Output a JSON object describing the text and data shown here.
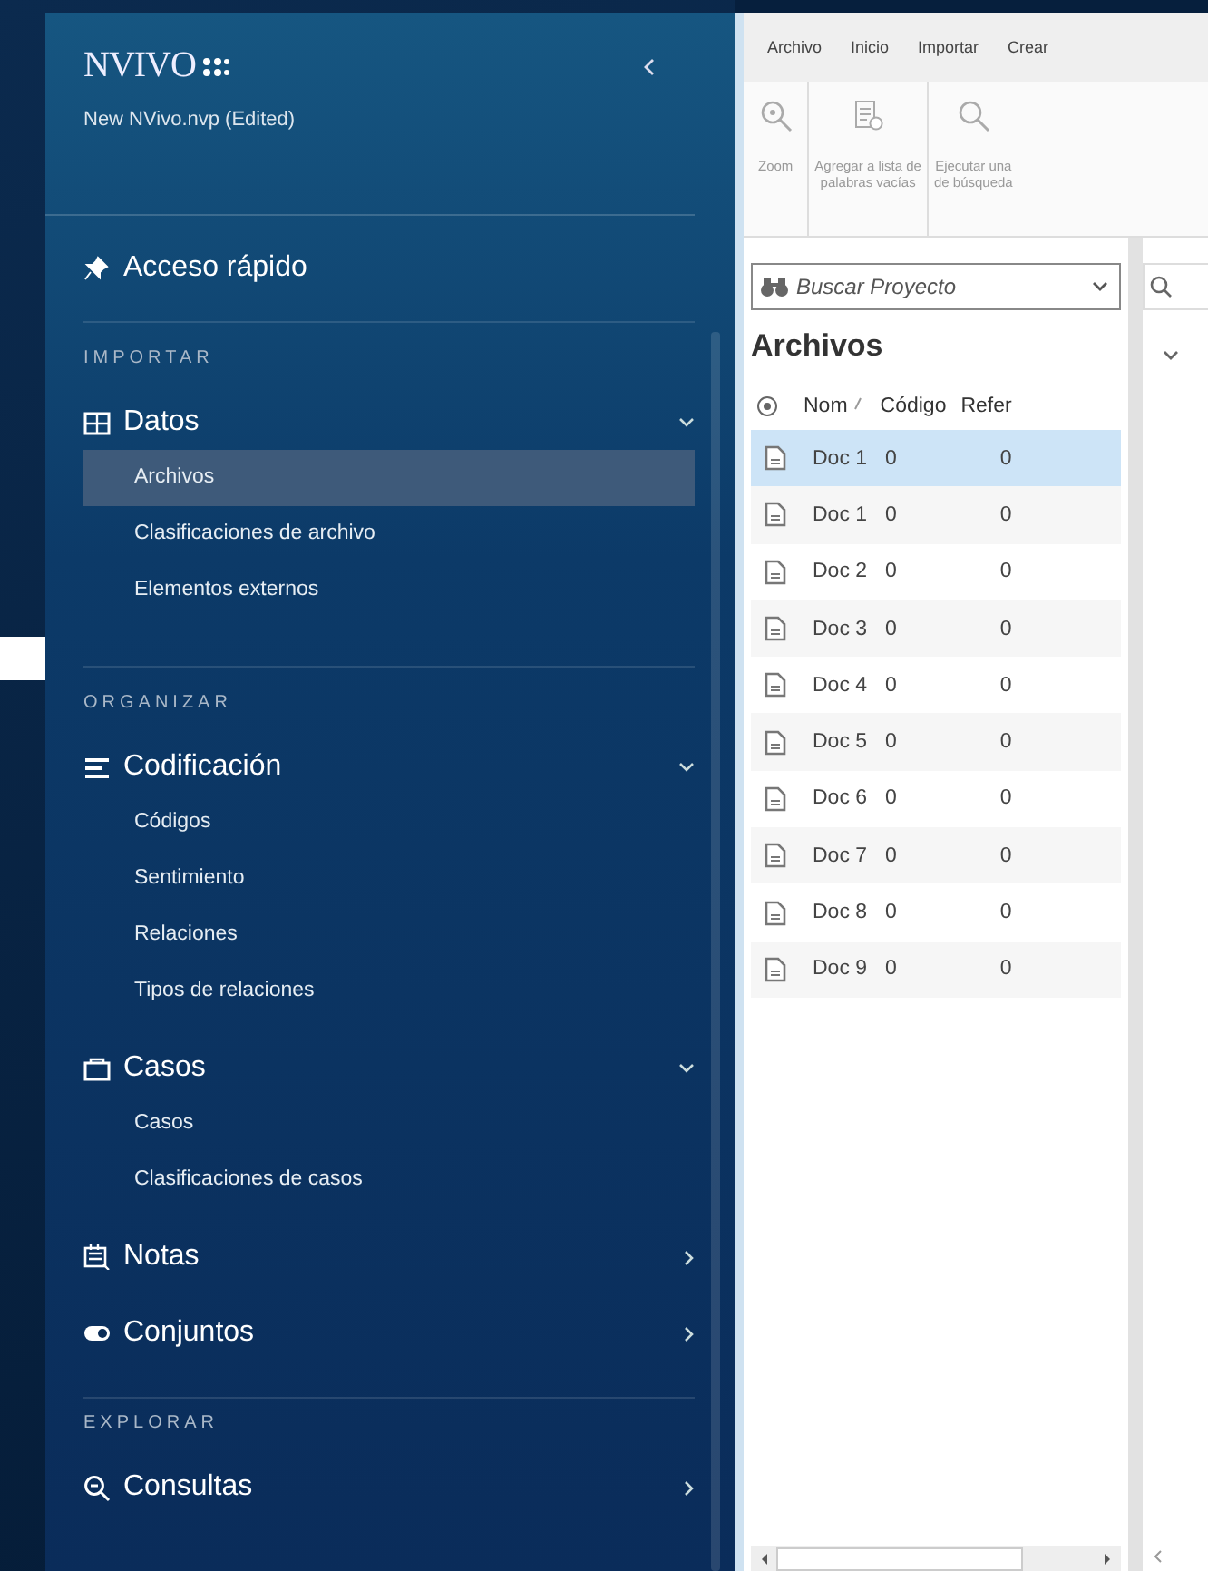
{
  "sidebar": {
    "logo": "NVIVO",
    "project": "New NVivo.nvp (Edited)",
    "quick_access": {
      "label": "Acceso rápido"
    },
    "sections": [
      {
        "title": "IMPORTAR",
        "groups": [
          {
            "label": "Datos",
            "kind": "table",
            "expanded": true,
            "children": [
              {
                "label": "Archivos",
                "selected": true
              },
              {
                "label": "Clasificaciones de archivo",
                "selected": false
              },
              {
                "label": "Elementos externos",
                "selected": false
              }
            ]
          }
        ]
      },
      {
        "title": "ORGANIZAR",
        "groups": [
          {
            "label": "Codificación",
            "kind": "lines",
            "expanded": true,
            "children": [
              {
                "label": "Códigos",
                "selected": false
              },
              {
                "label": "Sentimiento",
                "selected": false
              },
              {
                "label": "Relaciones",
                "selected": false
              },
              {
                "label": "Tipos de relaciones",
                "selected": false
              }
            ]
          },
          {
            "label": "Casos",
            "kind": "case",
            "expanded": true,
            "children": [
              {
                "label": "Casos",
                "selected": false
              },
              {
                "label": "Clasificaciones de casos",
                "selected": false
              }
            ]
          },
          {
            "label": "Notas",
            "kind": "note",
            "expanded": false
          },
          {
            "label": "Conjuntos",
            "kind": "toggle",
            "expanded": false
          }
        ]
      },
      {
        "title": "EXPLORAR",
        "groups": [
          {
            "label": "Consultas",
            "kind": "search",
            "expanded": false
          }
        ]
      }
    ]
  },
  "ribbon": {
    "tabs": [
      {
        "label": "Archivo",
        "selected": false
      },
      {
        "label": "Inicio",
        "selected": false
      },
      {
        "label": "Importar",
        "selected": false
      },
      {
        "label": "Crear",
        "selected": false
      }
    ],
    "tools": [
      {
        "kind": "zoom",
        "lines": [
          "Zoom"
        ]
      },
      {
        "kind": "stopwords",
        "lines": [
          "Agregar a lista de",
          "palabras vacías"
        ]
      },
      {
        "kind": "query",
        "lines": [
          "Ejecutar una",
          "de búsqueda"
        ]
      }
    ]
  },
  "search": {
    "placeholder": "Buscar Proyecto"
  },
  "list": {
    "title": "Archivos",
    "columns": [
      "Nom",
      "Código",
      "Refer"
    ],
    "rows": [
      {
        "name": "Doc 1",
        "codes": "0",
        "references": "0",
        "selected": true
      },
      {
        "name": "Doc 1",
        "codes": "0",
        "references": "0",
        "selected": false
      },
      {
        "name": "Doc 2",
        "codes": "0",
        "references": "0",
        "selected": false
      },
      {
        "name": "Doc 3",
        "codes": "0",
        "references": "0",
        "selected": false
      },
      {
        "name": "Doc 4",
        "codes": "0",
        "references": "0",
        "selected": false
      },
      {
        "name": "Doc 5",
        "codes": "0",
        "references": "0",
        "selected": false
      },
      {
        "name": "Doc 6",
        "codes": "0",
        "references": "0",
        "selected": false
      },
      {
        "name": "Doc 7",
        "codes": "0",
        "references": "0",
        "selected": false
      },
      {
        "name": "Doc 8",
        "codes": "0",
        "references": "0",
        "selected": false
      },
      {
        "name": "Doc 9",
        "codes": "0",
        "references": "0",
        "selected": false
      }
    ]
  }
}
